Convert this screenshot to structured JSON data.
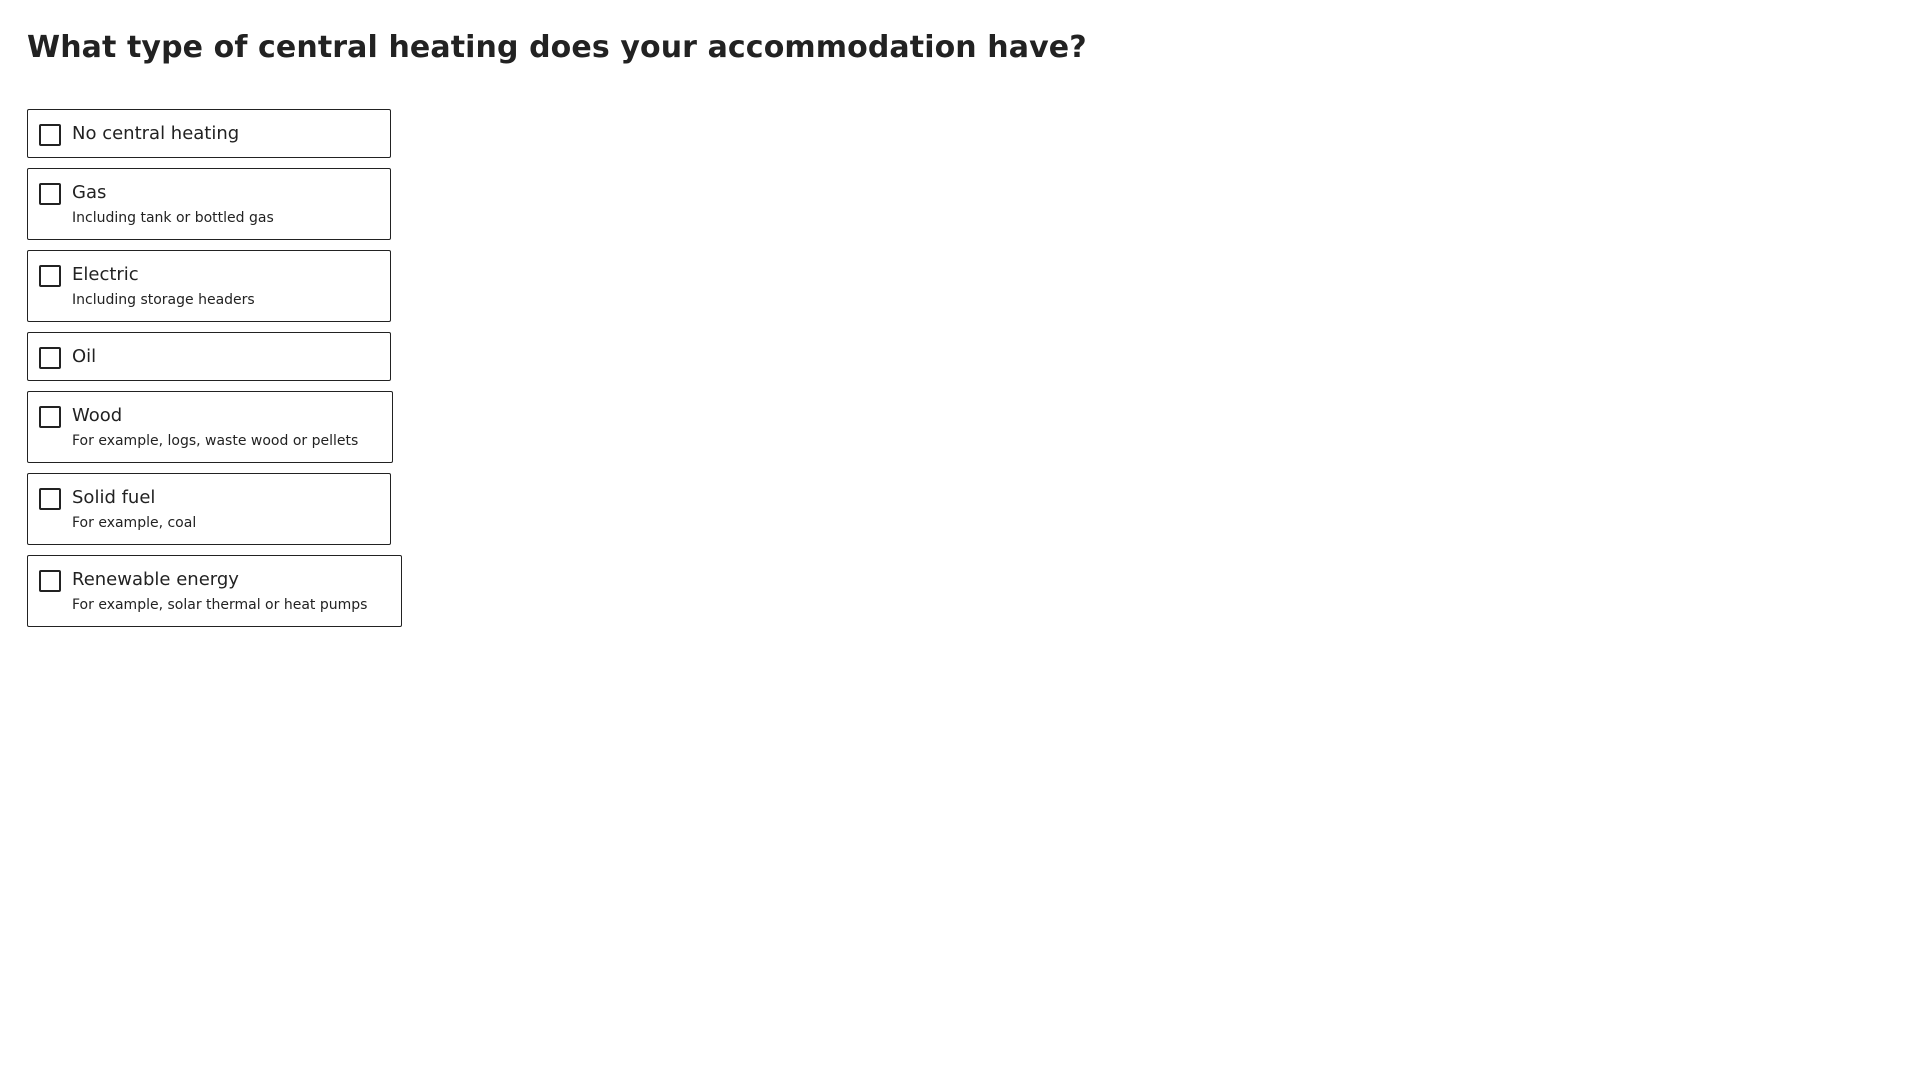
{
  "question": {
    "title": "What type of central heating does your accommodation have?"
  },
  "options": [
    {
      "label": "No central heating",
      "hint": ""
    },
    {
      "label": "Gas",
      "hint": "Including tank or bottled gas"
    },
    {
      "label": "Electric",
      "hint": "Including storage headers"
    },
    {
      "label": "Oil",
      "hint": ""
    },
    {
      "label": "Wood",
      "hint": "For example, logs, waste wood or pellets"
    },
    {
      "label": "Solid fuel",
      "hint": "For example, coal"
    },
    {
      "label": "Renewable energy",
      "hint": "For example, solar thermal or heat pumps"
    }
  ]
}
